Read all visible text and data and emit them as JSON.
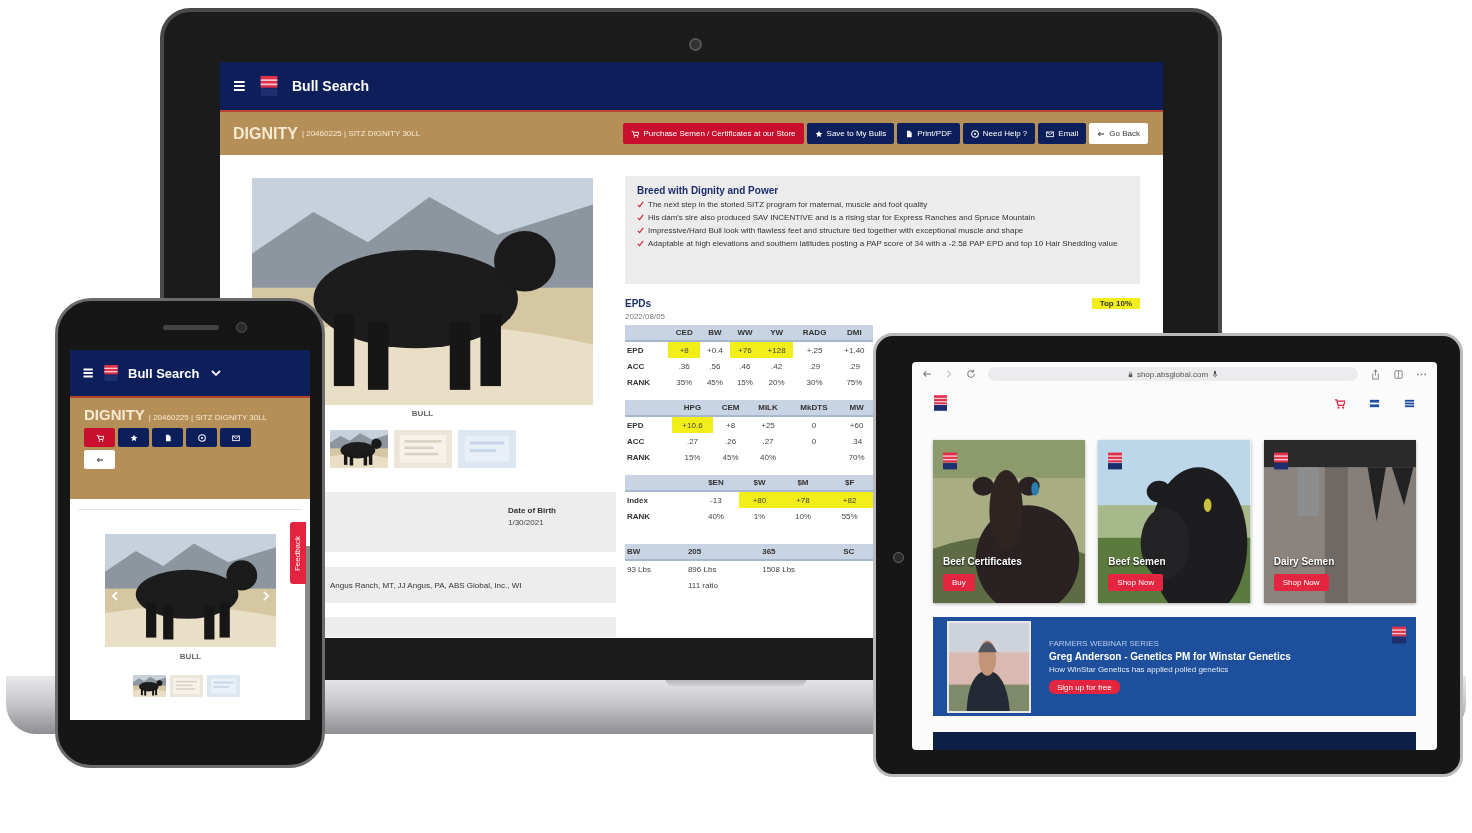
{
  "laptop": {
    "header": {
      "title": "Bull Search"
    },
    "bull_bar": {
      "name": "DIGNITY",
      "registration": "| 20460225 | SITZ DIGNITY 30LL",
      "actions": [
        {
          "kind": "store",
          "label": "Purchase Semen / Certificates at our Store"
        },
        {
          "kind": "save",
          "label": "Save to My Bulls"
        },
        {
          "kind": "print",
          "label": "Print/PDF"
        },
        {
          "kind": "help",
          "label": "Need Help ?"
        },
        {
          "kind": "email",
          "label": "Email"
        },
        {
          "kind": "back",
          "label": "Go Back"
        }
      ]
    },
    "photo_caption": "BULL",
    "details": [
      {
        "label": "Date of Birth",
        "value": "1/30/2021"
      }
    ],
    "breeders": "Angus Ranch, MT, JJ Angus, PA, ABS Global, Inc., WI",
    "highlights": {
      "title": "Breed with Dignity and Power",
      "items": [
        "The next step in the storied SITZ program for maternal, muscle and foot quality",
        "His dam's sire also produced SAV INCENTIVE and is a rising star for Express Ranches and Spruce Mountain",
        "Impressive/Hard Bull look with flawless feet and structure tied together with exceptional muscle and shape",
        "Adaptable at high elevations and southern latitudes posting a PAP score of 34 with a -2.58 PAP EPD and top 10 Hair Shedding value"
      ]
    },
    "epds": {
      "title": "EPDs",
      "date": "2022/08/05",
      "badge": "Top 10%",
      "tables": [
        {
          "columns": [
            "CED",
            "BW",
            "WW",
            "YW",
            "RADG",
            "DMI"
          ],
          "rows": [
            {
              "label": "EPD",
              "cells": [
                {
                  "text": "+8",
                  "highlight": true
                },
                {
                  "text": "+0.4",
                  "highlight": false
                },
                {
                  "text": "+76",
                  "highlight": true
                },
                {
                  "text": "+128",
                  "highlight": true
                },
                {
                  "text": "+.25",
                  "highlight": false
                },
                {
                  "text": "+1.40",
                  "highlight": false
                }
              ]
            },
            {
              "label": "ACC",
              "cells": [
                {
                  "text": ".36",
                  "highlight": false
                },
                {
                  "text": ".56",
                  "highlight": false
                },
                {
                  "text": ".46",
                  "highlight": false
                },
                {
                  "text": ".42",
                  "highlight": false
                },
                {
                  "text": ".29",
                  "highlight": false
                },
                {
                  "text": ".29",
                  "highlight": false
                }
              ]
            },
            {
              "label": "RANK",
              "cells": [
                {
                  "text": "35%",
                  "highlight": false
                },
                {
                  "text": "45%",
                  "highlight": false
                },
                {
                  "text": "15%",
                  "highlight": false
                },
                {
                  "text": "20%",
                  "highlight": false
                },
                {
                  "text": "30%",
                  "highlight": false
                },
                {
                  "text": "75%",
                  "highlight": false
                }
              ]
            }
          ]
        },
        {
          "columns": [
            "HPG",
            "CEM",
            "MILK",
            "MkDTS",
            "MW"
          ],
          "rows": [
            {
              "label": "EPD",
              "cells": [
                {
                  "text": "+10.6",
                  "highlight": true
                },
                {
                  "text": "+8",
                  "highlight": false
                },
                {
                  "text": "+25",
                  "highlight": false
                },
                {
                  "text": "0",
                  "highlight": false
                },
                {
                  "text": "+60",
                  "highlight": false
                }
              ]
            },
            {
              "label": "ACC",
              "cells": [
                {
                  "text": ".27",
                  "highlight": false
                },
                {
                  "text": ".26",
                  "highlight": false
                },
                {
                  "text": ".27",
                  "highlight": false
                },
                {
                  "text": "0",
                  "highlight": false
                },
                {
                  "text": ".34",
                  "highlight": false
                }
              ]
            },
            {
              "label": "RANK",
              "cells": [
                {
                  "text": "15%",
                  "highlight": false
                },
                {
                  "text": "45%",
                  "highlight": false
                },
                {
                  "text": "40%",
                  "highlight": false
                },
                {
                  "highlight": false
                },
                {
                  "text": "70%",
                  "highlight": false
                }
              ]
            }
          ]
        },
        {
          "columns": [
            "$EN",
            "$W",
            "$M",
            "$F"
          ],
          "rows": [
            {
              "label": "Index",
              "cells": [
                {
                  "text": "-13",
                  "highlight": false
                },
                {
                  "text": "+80",
                  "highlight": true
                },
                {
                  "text": "+78",
                  "highlight": true
                },
                {
                  "text": "+82",
                  "highlight": true
                }
              ]
            },
            {
              "label": "RANK",
              "cells": [
                {
                  "text": "40%",
                  "highlight": false
                },
                {
                  "text": "1%",
                  "highlight": false
                },
                {
                  "text": "10%",
                  "highlight": false
                },
                {
                  "text": "55%",
                  "highlight": false
                }
              ]
            }
          ]
        },
        {
          "columns": [
            "BW",
            "205",
            "365",
            "SC"
          ],
          "rows": [
            {
              "cells": [
                {
                  "text": "93 Lbs",
                  "highlight": false
                },
                {
                  "text": "896 Lbs",
                  "highlight": false
                },
                {
                  "text": "1508 Lbs",
                  "highlight": false
                },
                {
                  "highlight": false
                }
              ]
            },
            {
              "cells": [
                {
                  "highlight": false
                },
                {
                  "text": "111 ratio",
                  "highlight": false
                },
                {
                  "highlight": false
                },
                {
                  "highlight": false
                }
              ]
            }
          ]
        }
      ]
    }
  },
  "phone": {
    "header": {
      "title": "Bull Search"
    },
    "bull_bar": {
      "name": "DIGNITY",
      "registration": "| 20460225 | SITZ DIGNITY 30LL",
      "actions": [
        {
          "kind": "store"
        },
        {
          "kind": "save"
        },
        {
          "kind": "print"
        },
        {
          "kind": "help"
        },
        {
          "kind": "email"
        },
        {
          "kind": "back"
        }
      ]
    },
    "photo_caption": "BULL",
    "feedback": "Feedback"
  },
  "tablet": {
    "url": "shop.absglobal.com",
    "cards": [
      {
        "title": "Beef Certificates",
        "button": "Buy"
      },
      {
        "title": "Beef Semen",
        "button": "Shop Now"
      },
      {
        "title": "Dairy Semen",
        "button": "Shop Now"
      }
    ],
    "banner": {
      "eyebrow": "FARMERS WEBINAR SERIES",
      "title": "Greg Anderson - Genetics PM for Winstar Genetics",
      "subtitle": "How WinStar Genetics has applied polled genetics",
      "button": "Sign up for free"
    }
  }
}
